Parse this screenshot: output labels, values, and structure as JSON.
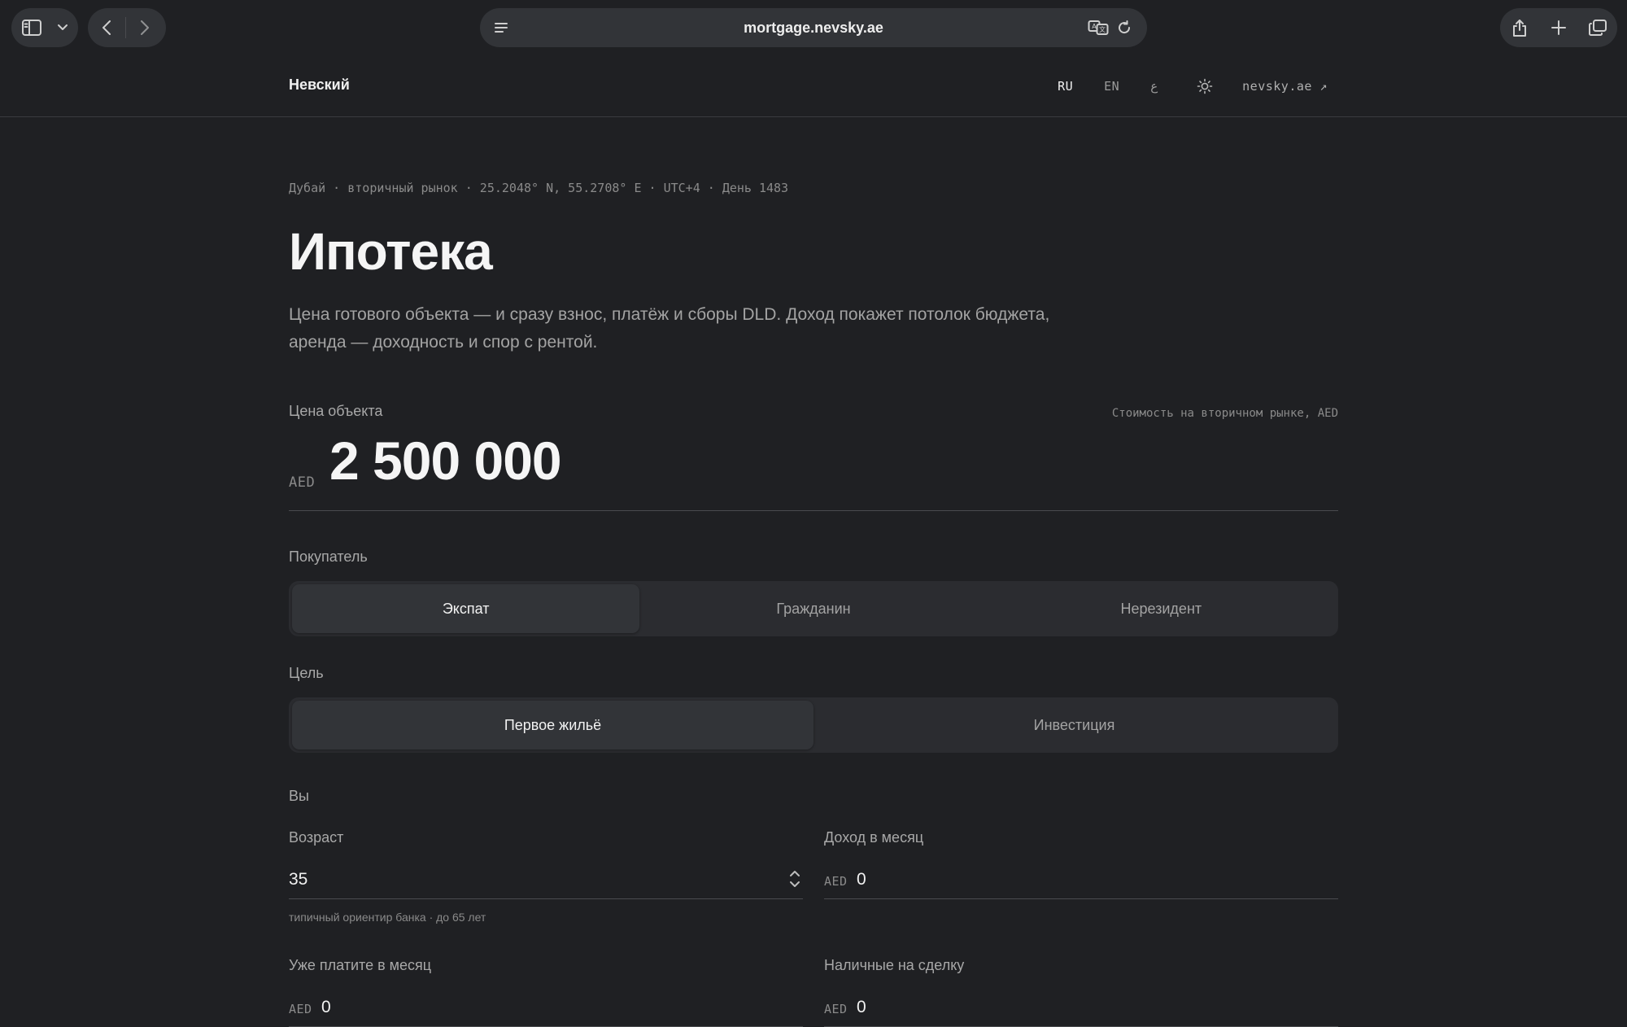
{
  "browser": {
    "url": "mortgage.nevsky.ae"
  },
  "header": {
    "brand": "Невский",
    "langs": [
      "RU",
      "EN",
      "ع"
    ],
    "external_link": "nevsky.ae ↗"
  },
  "hero": {
    "meta": "Дубай · вторичный рынок · 25.2048° N, 55.2708° E · UTC+4 · День 1483",
    "title": "Ипотека",
    "lead": "Цена готового объекта — и сразу взнос, платёж и сборы DLD. Доход покажет потолок бюджета, аренда — доходность и спор с рентой."
  },
  "price": {
    "label": "Цена объекта",
    "hint": "Стоимость на вторичном рынке, AED",
    "currency": "AED",
    "value": "2 500 000"
  },
  "buyer": {
    "label": "Покупатель",
    "options": [
      "Экспат",
      "Гражданин",
      "Нерезидент"
    ],
    "selected": "Экспат"
  },
  "goal": {
    "label": "Цель",
    "options": [
      "Первое жильё",
      "Инвестиция"
    ],
    "selected": "Первое жильё"
  },
  "you": {
    "section_label": "Вы",
    "age": {
      "label": "Возраст",
      "value": "35",
      "hint": "типичный ориентир банка · до 65 лет"
    },
    "income": {
      "label": "Доход в месяц",
      "currency": "AED",
      "value": "0"
    },
    "paying": {
      "label": "Уже платите в месяц",
      "currency": "AED",
      "value": "0"
    },
    "cash": {
      "label": "Наличные на сделку",
      "currency": "AED",
      "value": "0"
    }
  }
}
